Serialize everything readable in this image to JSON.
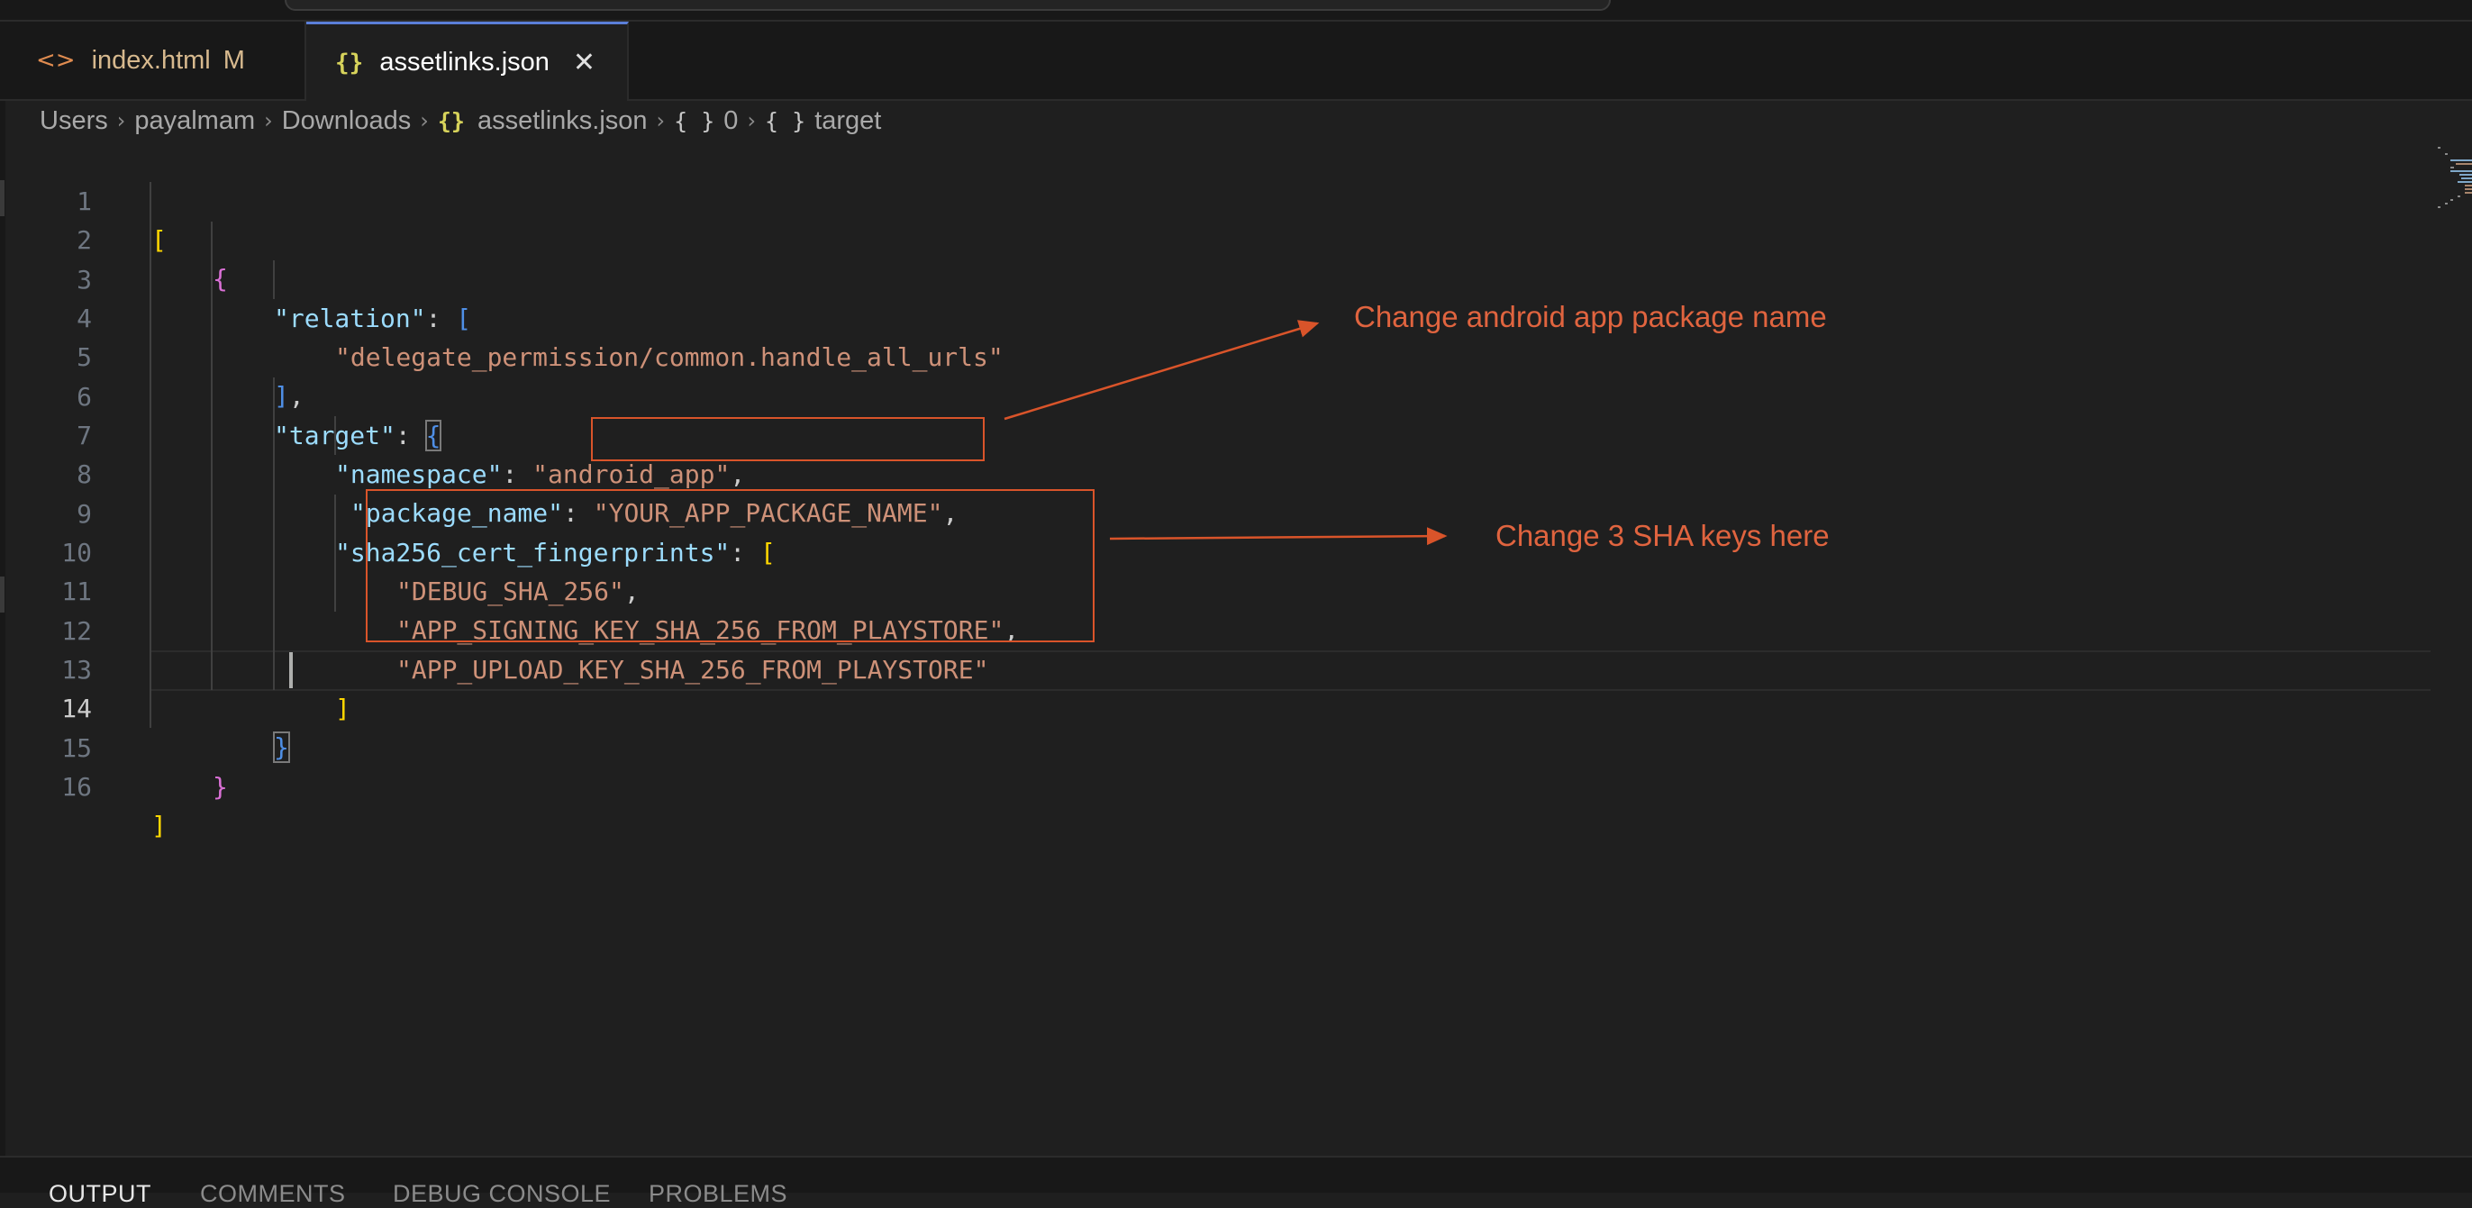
{
  "tabs": [
    {
      "label": "index.html",
      "icon": "html-brackets-icon",
      "icon_glyph": "<>",
      "badge": "M",
      "active": false
    },
    {
      "label": "assetlinks.json",
      "icon": "json-braces-icon",
      "icon_glyph": "{}",
      "close_glyph": "✕",
      "active": true
    }
  ],
  "breadcrumb": {
    "items": [
      "Users",
      "payalmam",
      "Downloads",
      "assetlinks.json",
      "0",
      "target"
    ],
    "separator": "›",
    "file_icon_glyph": "{}",
    "object_icon_glyph": "{ }"
  },
  "editor": {
    "current_line": 14,
    "line_numbers": [
      "1",
      "2",
      "3",
      "4",
      "5",
      "6",
      "7",
      "8",
      "9",
      "10",
      "11",
      "12",
      "13",
      "14",
      "15",
      "16"
    ],
    "code": {
      "l1": {
        "open": "["
      },
      "l2": {
        "open": "{"
      },
      "l3": {
        "key": "\"relation\"",
        "colon": ": ",
        "open": "["
      },
      "l4": {
        "value": "\"delegate_permission/common.handle_all_urls\""
      },
      "l5": {
        "close": "]",
        "comma": ","
      },
      "l6": {
        "key": "\"target\"",
        "colon": ": ",
        "open": "{"
      },
      "l7": {
        "key": "\"namespace\"",
        "colon": ": ",
        "value": "\"android_app\"",
        "comma": ","
      },
      "l8": {
        "key": "\"package_name\"",
        "colon": ": ",
        "value": "\"YOUR_APP_PACKAGE_NAME\"",
        "comma": ","
      },
      "l9": {
        "key": "\"sha256_cert_fingerprints\"",
        "colon": ": ",
        "open": "["
      },
      "l10": {
        "value": "\"DEBUG_SHA_256\"",
        "comma": ","
      },
      "l11": {
        "value": "\"APP_SIGNING_KEY_SHA_256_FROM_PLAYSTORE\"",
        "comma": ","
      },
      "l12": {
        "value": "\"APP_UPLOAD_KEY_SHA_256_FROM_PLAYSTORE\""
      },
      "l13": {
        "close": "]"
      },
      "l14": {
        "close": "}"
      },
      "l15": {
        "close": "}"
      },
      "l16": {
        "close": "]"
      }
    }
  },
  "annotations": {
    "package_note": "Change android app package name",
    "sha_note": "Change 3 SHA keys here",
    "color": "#d9542a"
  },
  "panel": {
    "tabs": [
      "OUTPUT",
      "COMMENTS",
      "DEBUG CONSOLE",
      "PROBLEMS"
    ],
    "active": "OUTPUT"
  },
  "colors": {
    "editor_bg": "#1f1f1f",
    "active_tab_border": "#5b7fd9",
    "json_key": "#9cdcfe",
    "json_string": "#ce9178",
    "bracket_level1": "#ffd700",
    "bracket_level2": "#da70d6",
    "bracket_level3": "#4f8fe6"
  }
}
